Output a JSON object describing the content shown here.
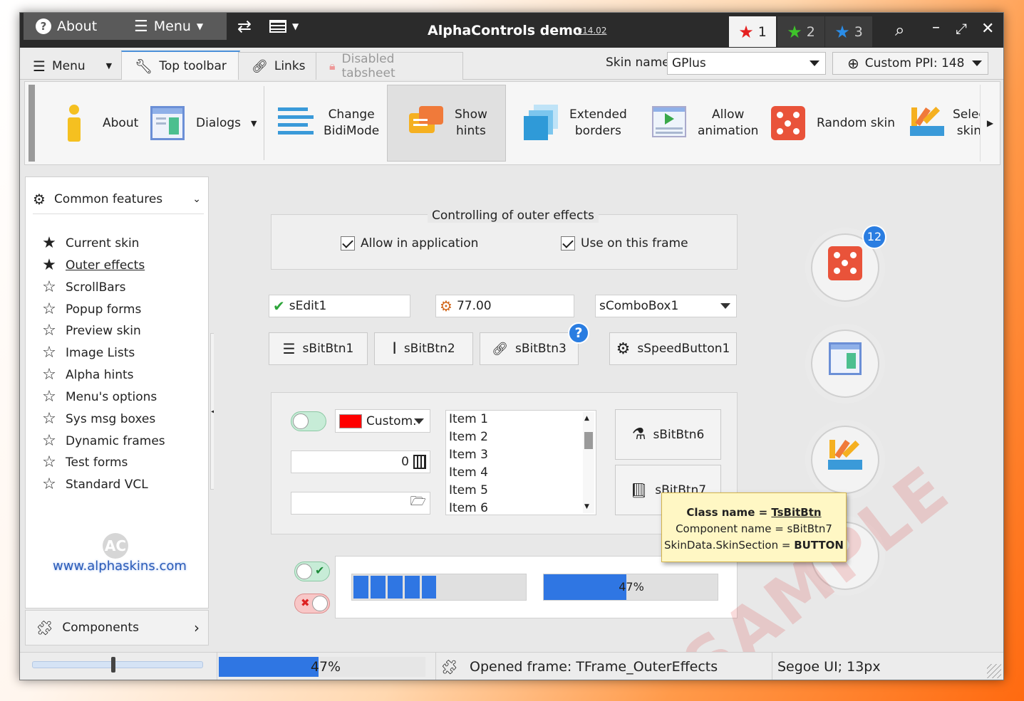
{
  "titlebar": {
    "about": "About",
    "menu": "Menu",
    "title": "AlphaControls demo",
    "version": "v14.02",
    "star_tabs": [
      {
        "label": "1",
        "color": "#e52020"
      },
      {
        "label": "2",
        "color": "#3ec32a"
      },
      {
        "label": "3",
        "color": "#2a8de8"
      }
    ]
  },
  "tabs": {
    "menu": "Menu",
    "top_toolbar": "Top toolbar",
    "links": "Links",
    "disabled": "Disabled tabsheet",
    "skin_label": "Skin name:",
    "skin_value": "GPlus",
    "ppi": "Custom PPI: 148"
  },
  "toolbar": {
    "about": "About",
    "dialogs": "Dialogs",
    "bidi": [
      "Change",
      "BidiMode"
    ],
    "hints": [
      "Show",
      "hints"
    ],
    "borders": [
      "Extended",
      "borders"
    ],
    "anim": [
      "Allow",
      "animation"
    ],
    "random": "Random skin",
    "select": [
      "Selec",
      "skin"
    ]
  },
  "sidebar": {
    "header": "Common features",
    "items": [
      "Current skin",
      "Outer effects",
      "ScrollBars",
      "Popup forms",
      "Preview skin",
      "Image Lists",
      "Alpha hints",
      "Menu's options",
      "Sys msg boxes",
      "Dynamic frames",
      "Test forms",
      "Standard VCL"
    ],
    "url": "www.alphaskins.com",
    "components": "Components"
  },
  "main": {
    "group_title": "Controlling of outer effects",
    "allow_app": "Allow in application",
    "use_frame": "Use on this frame",
    "edit1": "sEdit1",
    "num": "77.00",
    "combo": "sComboBox1",
    "btn1": "sBitBtn1",
    "btn2": "sBitBtn2",
    "btn3": "sBitBtn3",
    "speed": "sSpeedButton1",
    "color_combo": "Custom.",
    "calc_value": "0",
    "list_items": [
      "Item 1",
      "Item 2",
      "Item 3",
      "Item 4",
      "Item 5",
      "Item 6"
    ],
    "btn6": "sBitBtn6",
    "btn7": "sBitBtn7",
    "progress2_text": "47%",
    "badge": "12",
    "watermark": "SAMPLE"
  },
  "hint": {
    "line1_label": "Class name = ",
    "line1_value": "TsBitBtn",
    "line2": "Component name = sBitBtn7",
    "line3_label": "SkinData.SkinSection = ",
    "line3_value": "BUTTON"
  },
  "status": {
    "progress": "47%",
    "opened": "Opened frame: TFrame_OuterEffects",
    "font": "Segoe UI; 13px"
  }
}
